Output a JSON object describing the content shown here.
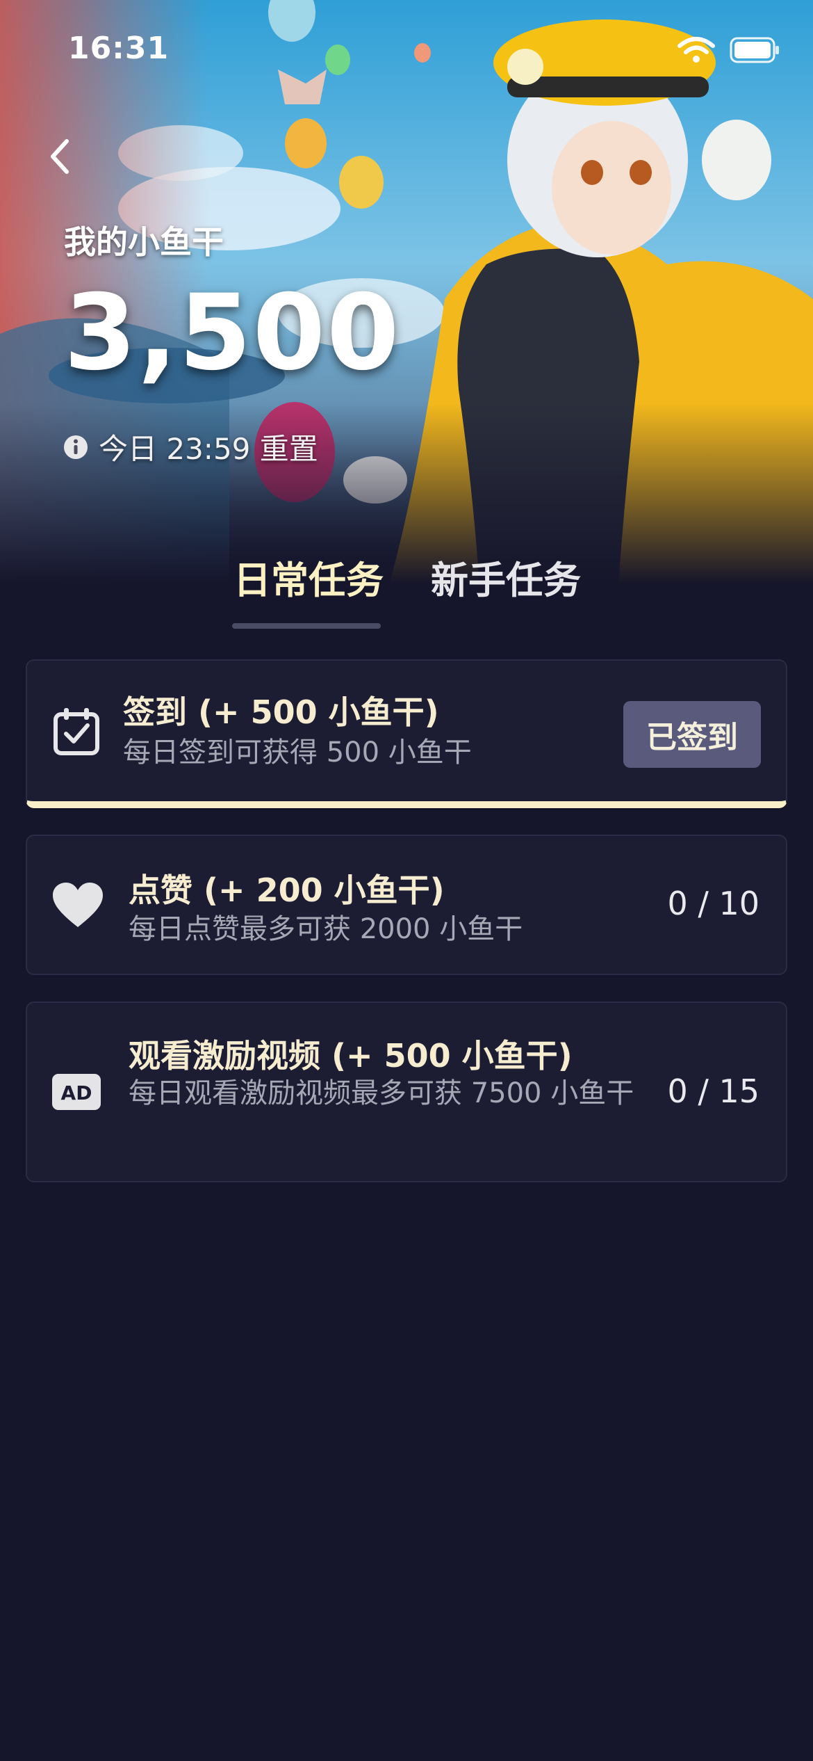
{
  "status_bar": {
    "time": "16:31"
  },
  "header": {
    "balance_label": "我的小鱼干",
    "balance_value": "3,500",
    "reset_text": "今日 23:59 重置"
  },
  "tabs": [
    {
      "label": "日常任务",
      "active": true
    },
    {
      "label": "新手任务",
      "active": false
    }
  ],
  "tasks": [
    {
      "icon": "calendar-check-icon",
      "title": "签到 (+ 500 小鱼干)",
      "description": "每日签到可获得 500 小鱼干",
      "action_label": "已签到"
    },
    {
      "icon": "heart-icon",
      "title": "点赞 (+ 200 小鱼干)",
      "description": "每日点赞最多可获 2000 小鱼干",
      "progress": "0 / 10"
    },
    {
      "icon": "ad-icon",
      "title": "观看激励视频 (+ 500 小鱼干)",
      "description": "每日观看激励视频最多可获 7500 小鱼干",
      "progress": "0 / 15"
    }
  ],
  "colors": {
    "background": "#15152b",
    "card": "#1c1c33",
    "accent_cream": "#f8f0c8",
    "button": "#5a5b7c"
  }
}
